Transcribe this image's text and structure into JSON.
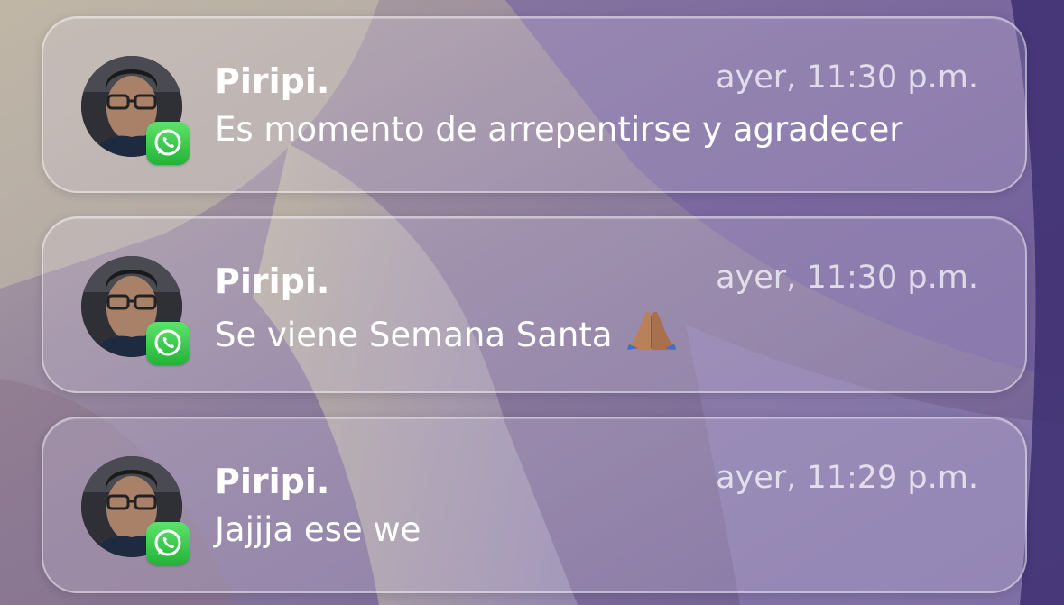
{
  "notifications": [
    {
      "sender": "Piripi.",
      "time": "ayer, 11:30 p.m.",
      "message": "Es momento de arrepentirse y agradecer",
      "app_icon": "whatsapp-icon"
    },
    {
      "sender": "Piripi.",
      "time": "ayer, 11:30 p.m.",
      "message": "Se viene Semana Santa",
      "emoji": "🙏🏽",
      "app_icon": "whatsapp-icon"
    },
    {
      "sender": "Piripi.",
      "time": "ayer, 11:29 p.m.",
      "message": "Jajjja ese we",
      "app_icon": "whatsapp-icon"
    }
  ],
  "colors": {
    "app_badge": "#25D366",
    "card_border": "#ffffff",
    "timestamp_text": "#e6e0ec"
  }
}
